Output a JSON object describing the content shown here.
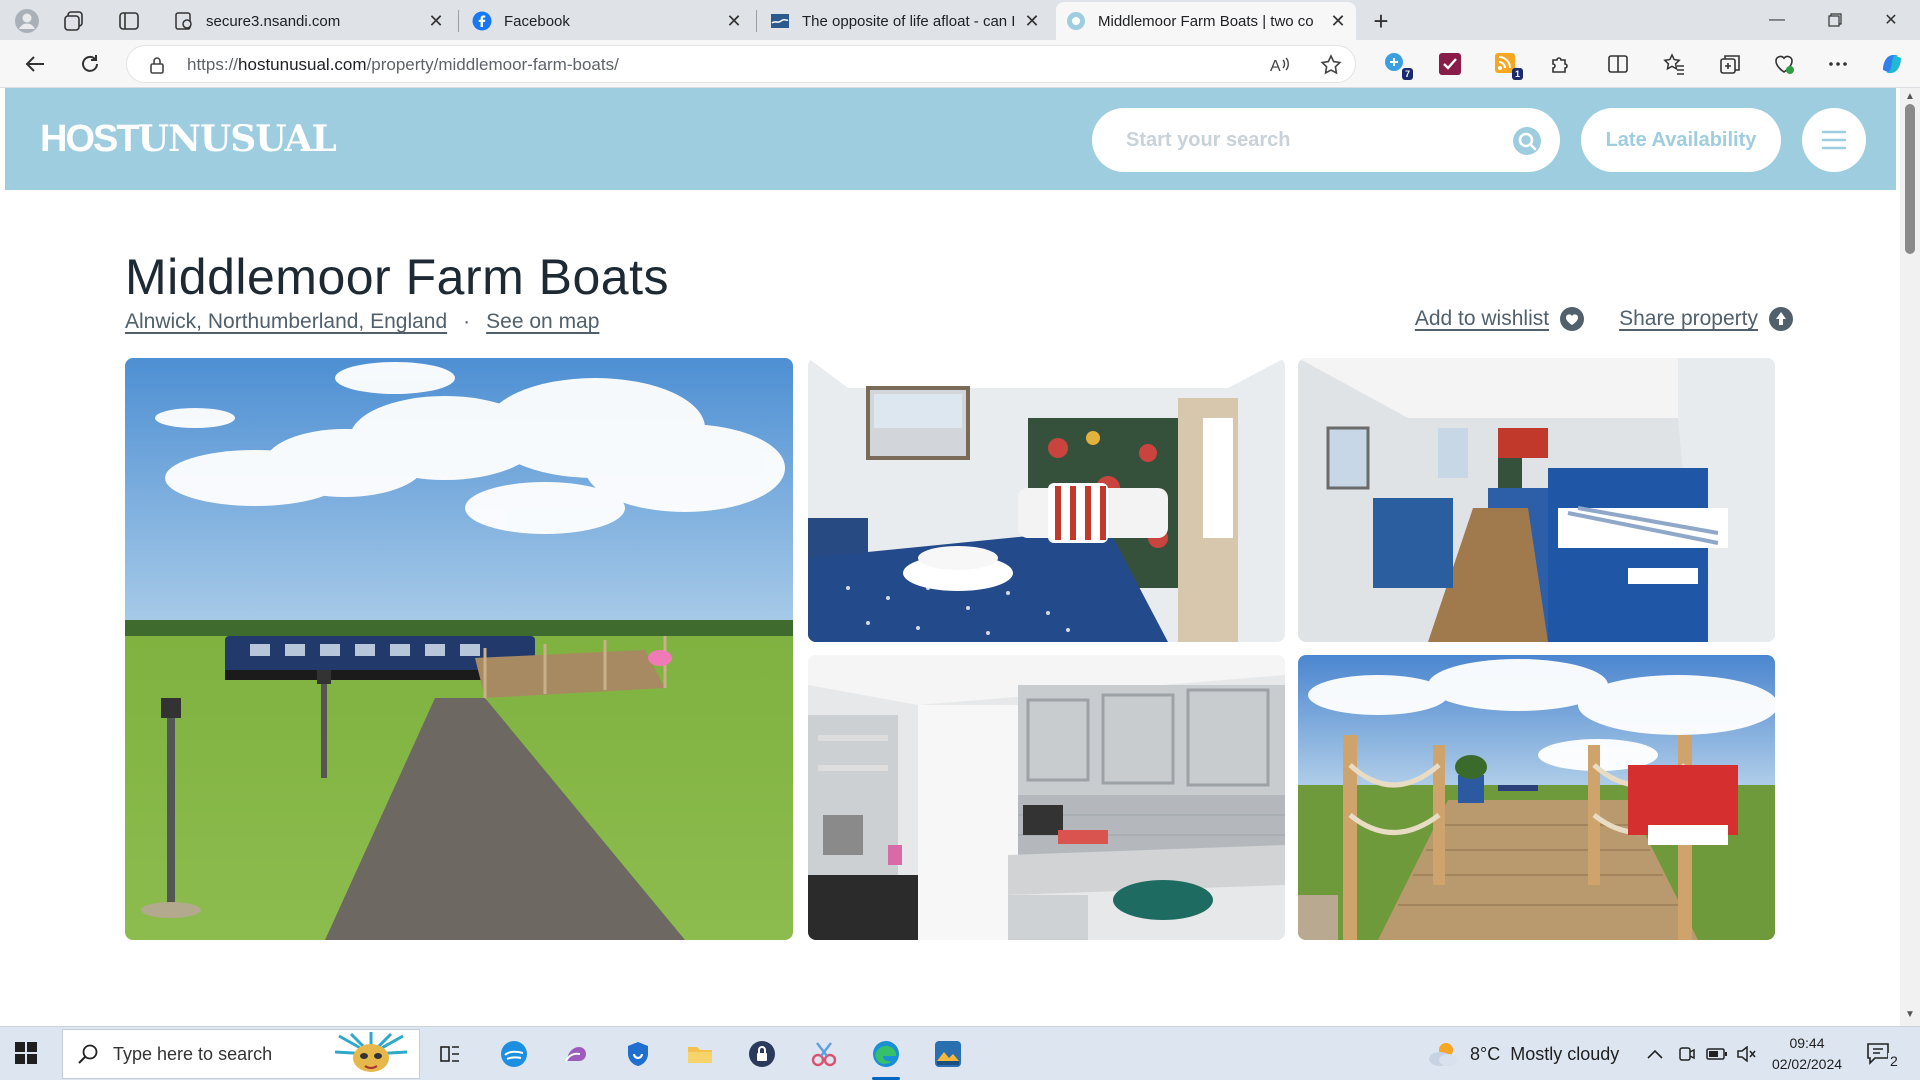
{
  "browser": {
    "tabs": [
      {
        "title": "secure3.nsandi.com",
        "active": false
      },
      {
        "title": "Facebook",
        "active": false
      },
      {
        "title": "The opposite of life afloat - can I",
        "active": false
      },
      {
        "title": "Middlemoor Farm Boats | two co",
        "active": true
      }
    ],
    "url_prefix": "https://",
    "url_host": "hostunusual.com",
    "url_path": "/property/middlemoor-farm-boats/",
    "extension_badges": [
      "7",
      "1"
    ]
  },
  "site": {
    "logo_host": "HOST",
    "logo_unusual": "UNUSUAL",
    "search_placeholder": "Start your search",
    "late_availability_label": "Late Availability",
    "accent_color": "#9fcde0"
  },
  "property": {
    "title": "Middlemoor Farm Boats",
    "location": "Alnwick, Northumberland, England",
    "separator": "·",
    "map_link": "See on map",
    "wishlist_label": "Add to wishlist",
    "share_label": "Share property"
  },
  "taskbar": {
    "search_placeholder": "Type here to search",
    "weather_temp": "8°C",
    "weather_text": "Mostly cloudy",
    "time": "09:44",
    "date": "02/02/2024",
    "notification_count": "2"
  }
}
